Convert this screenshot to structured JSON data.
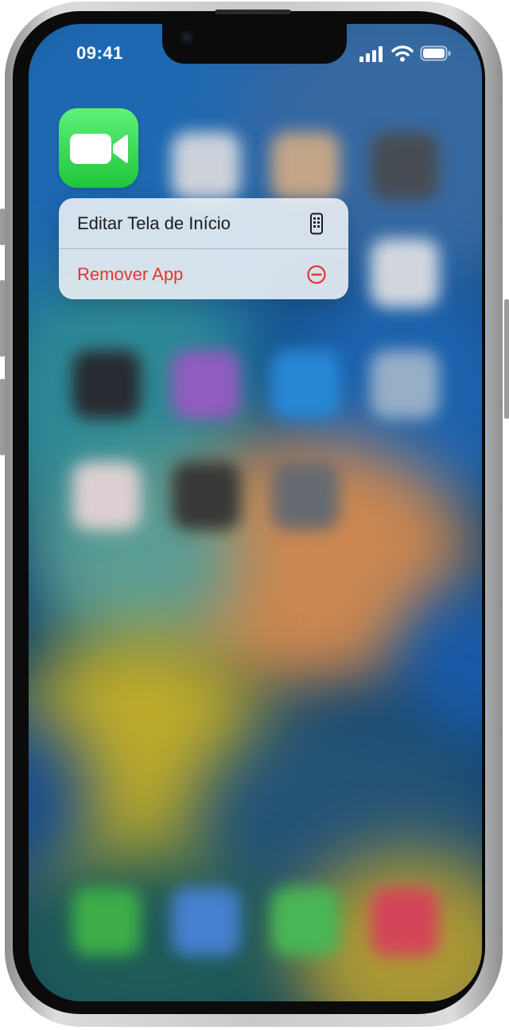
{
  "status_bar": {
    "time": "09:41",
    "icons": [
      "cellular-signal-icon",
      "wifi-icon",
      "battery-icon"
    ]
  },
  "focused_app": {
    "icon": "facetime-video-camera-icon",
    "color": "#28cd41"
  },
  "context_menu": {
    "items": [
      {
        "label": "Editar Tela de Início",
        "icon": "phone-screen-icon",
        "style": "normal"
      },
      {
        "label": "Remover App",
        "icon": "minus-circle-icon",
        "style": "destructive"
      }
    ]
  },
  "colors": {
    "destructive": "#e5352c",
    "menu_background": "#e9eef3",
    "facetime_green": "#28cd41"
  }
}
